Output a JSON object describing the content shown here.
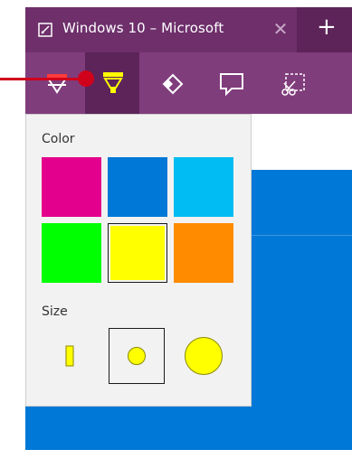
{
  "tab": {
    "title": "Windows 10 – Microsoft",
    "close_glyph": "✕",
    "new_tab_glyph": "+"
  },
  "toolbar": {
    "tools": [
      {
        "name": "pen",
        "icon": "pen-icon",
        "selected": false
      },
      {
        "name": "highlighter",
        "icon": "highlighter-icon",
        "selected": true
      },
      {
        "name": "eraser",
        "icon": "eraser-icon",
        "selected": false
      },
      {
        "name": "comment",
        "icon": "comment-icon",
        "selected": false
      },
      {
        "name": "clip",
        "icon": "clip-icon",
        "selected": false
      }
    ]
  },
  "popup": {
    "color_label": "Color",
    "size_label": "Size",
    "colors": [
      {
        "name": "magenta",
        "hex": "#e3008c",
        "selected": false
      },
      {
        "name": "blue",
        "hex": "#0078d7",
        "selected": false
      },
      {
        "name": "cyan",
        "hex": "#00bcf2",
        "selected": false
      },
      {
        "name": "green",
        "hex": "#00ff00",
        "selected": false
      },
      {
        "name": "yellow",
        "hex": "#ffff00",
        "selected": true
      },
      {
        "name": "orange",
        "hex": "#ff8c00",
        "selected": false
      }
    ],
    "sizes": [
      {
        "name": "small",
        "selected": false
      },
      {
        "name": "medium",
        "selected": true
      },
      {
        "name": "large",
        "selected": false
      }
    ]
  },
  "colors": {
    "tab_bar": "#6e2f6b",
    "toolbar": "#803d7c",
    "selected_tool": "#5c2459",
    "page_blue": "#0078d7",
    "callout": "#d0021b",
    "highlight_yellow": "#ffff00"
  }
}
